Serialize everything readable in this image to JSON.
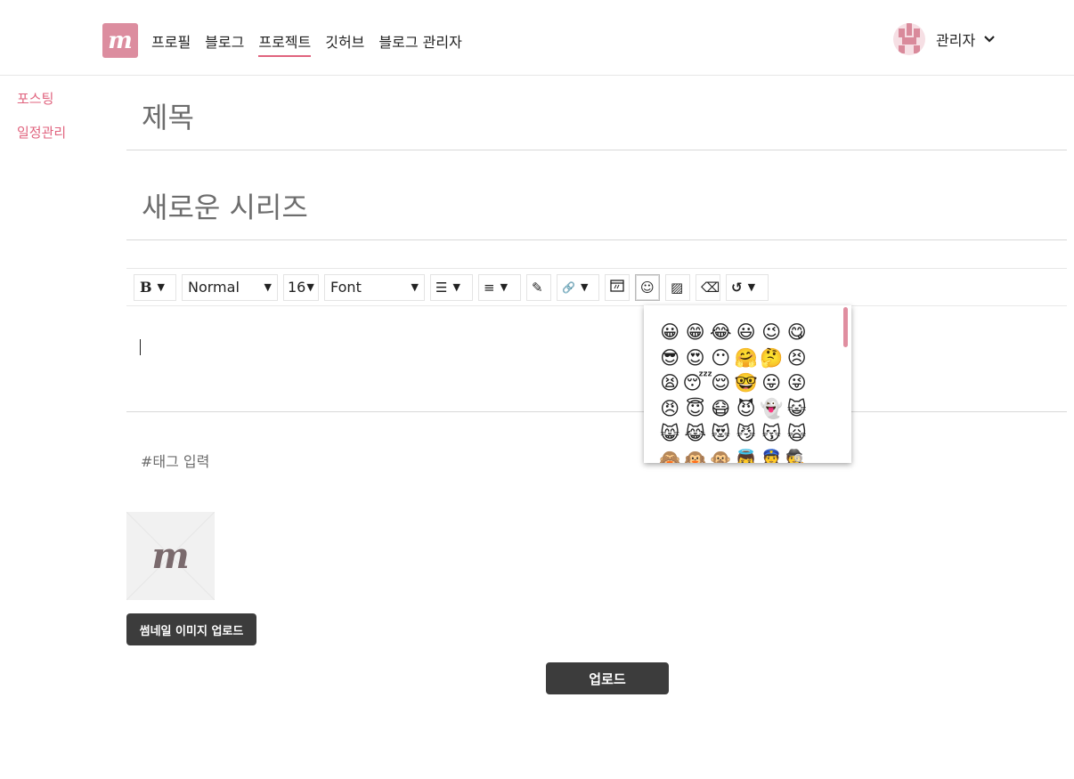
{
  "header": {
    "logo_text": "m",
    "nav": [
      {
        "label": "프로필"
      },
      {
        "label": "블로그"
      },
      {
        "label": "프로젝트"
      },
      {
        "label": "깃허브"
      },
      {
        "label": "블로그 관리자"
      }
    ],
    "active_nav": "프로젝트",
    "user": {
      "name": "관리자",
      "caret": "⌄"
    }
  },
  "sidebar": {
    "items": [
      {
        "label": "포스팅"
      },
      {
        "label": "일정관리"
      }
    ]
  },
  "form": {
    "title_placeholder": "제목",
    "series_placeholder": "새로운 시리즈",
    "tag_placeholder": "#태그 입력"
  },
  "toolbar": {
    "bold": "B",
    "paragraph_style": "Normal",
    "font_size": "16",
    "font": "Font",
    "caret": "▼",
    "icons": {
      "list": "☰",
      "align": "≡",
      "pen": "✎",
      "link": "🔗",
      "emoji": "☺",
      "image": "▨",
      "eraser": "⌫",
      "undo": "↺"
    }
  },
  "emoji_panel": {
    "emojis": [
      "😀",
      "😁",
      "😂",
      "😃",
      "😉",
      "😋",
      "😎",
      "😍",
      "😶",
      "🤗",
      "🤔",
      "😣",
      "😫",
      "😴",
      "😌",
      "🤓",
      "😛",
      "😜",
      "😠",
      "😇",
      "😷",
      "😈",
      "👻",
      "😺",
      "😸",
      "😹",
      "😻",
      "😼",
      "😽",
      "🙀",
      "🙈",
      "🙉",
      "🙊",
      "👼",
      "👮",
      "🕵"
    ]
  },
  "thumbnail": {
    "mark": "m",
    "upload_label": "썸네일 이미지 업로드"
  },
  "actions": {
    "upload_label": "업로드"
  },
  "colors": {
    "accent": "#e0637e",
    "logo_bg": "#dc8d9f",
    "dark_button": "#3c3c3c"
  }
}
